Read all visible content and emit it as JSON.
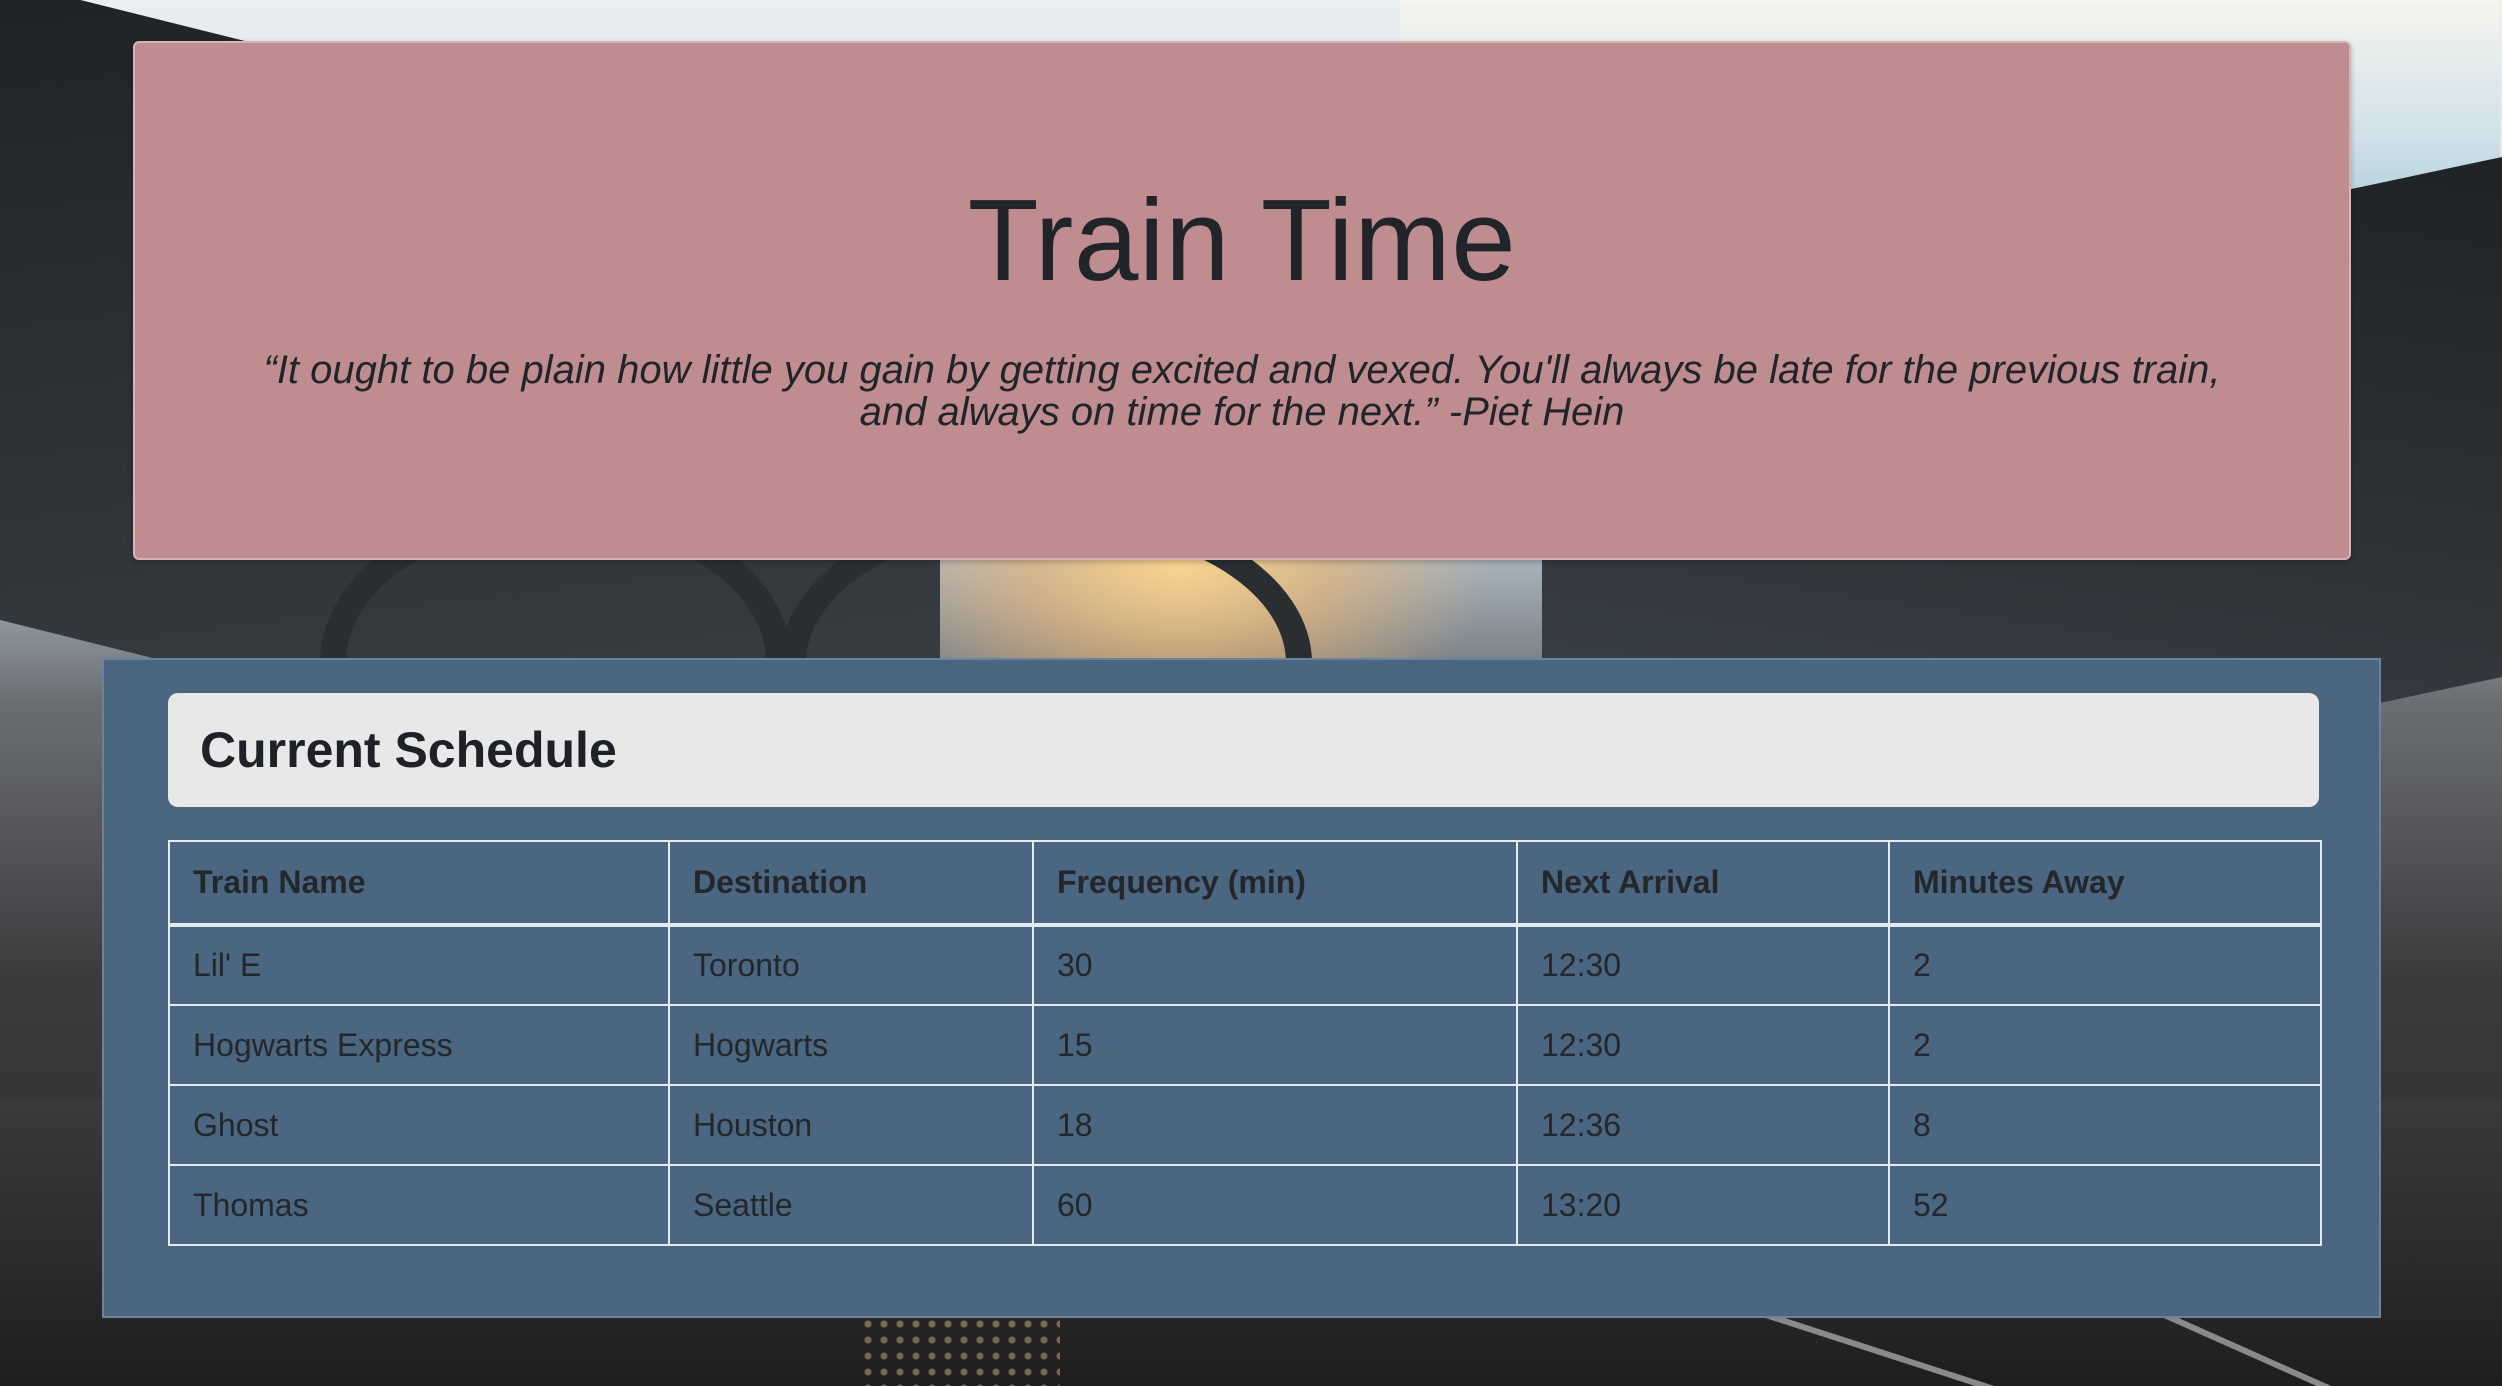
{
  "page": {
    "accent_colors": {
      "jumbotron_bg": "#bf8d8f",
      "panel_bg": "#4b6680",
      "card_header_bg": "#e8e8e8",
      "table_border": "#e6ebef"
    }
  },
  "header": {
    "title": "Train Time",
    "quote": "“It ought to be plain how little you gain by getting excited and vexed. You'll always be late for the previous train, and always on time for the next.” -Piet Hein"
  },
  "schedule": {
    "heading": "Current Schedule",
    "columns": [
      "Train Name",
      "Destination",
      "Frequency (min)",
      "Next Arrival",
      "Minutes Away"
    ],
    "rows": [
      [
        "Lil' E",
        "Toronto",
        "30",
        "12:30",
        "2"
      ],
      [
        "Hogwarts Express",
        "Hogwarts",
        "15",
        "12:30",
        "2"
      ],
      [
        "Ghost",
        "Houston",
        "18",
        "12:36",
        "8"
      ],
      [
        "Thomas",
        "Seattle",
        "60",
        "13:20",
        "52"
      ]
    ]
  }
}
